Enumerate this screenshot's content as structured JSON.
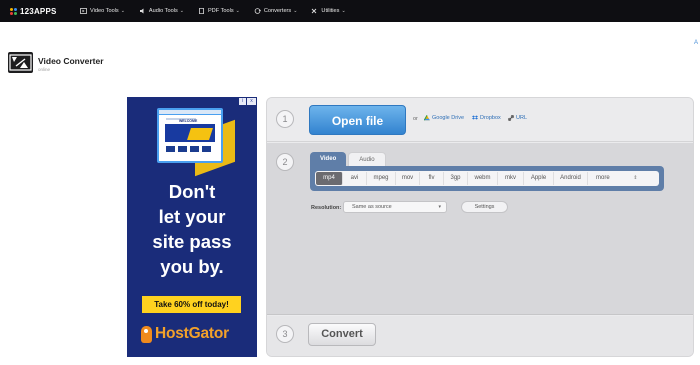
{
  "nav": {
    "logo": "123APPS",
    "items": [
      {
        "label": "Video Tools",
        "icon": "video-icon"
      },
      {
        "label": "Audio Tools",
        "icon": "audio-icon"
      },
      {
        "label": "PDF Tools",
        "icon": "pdf-icon"
      },
      {
        "label": "Converters",
        "icon": "converter-icon"
      },
      {
        "label": "Utilities",
        "icon": "utilities-icon"
      }
    ],
    "edge_letter": "A"
  },
  "app": {
    "title": "Video Converter",
    "subtitle": "online",
    "icon": "video-converter-icon"
  },
  "ad": {
    "headline_lines": [
      "Don't",
      "let your",
      "site pass",
      "you by."
    ],
    "cta": "Take 60% off today!",
    "brand": "HostGator",
    "mock_title": "WELCOME",
    "badge_info": "i",
    "badge_close": "x"
  },
  "steps": {
    "step1": "1",
    "step2": "2",
    "step3": "3"
  },
  "open": {
    "button": "Open file",
    "or": "or",
    "sources": [
      {
        "label": "Google Drive",
        "icon": "google-drive-icon",
        "color": "#2f9a48"
      },
      {
        "label": "Dropbox",
        "icon": "dropbox-icon",
        "color": "#2a77d6"
      },
      {
        "label": "URL",
        "icon": "link-icon",
        "color": "#555555"
      }
    ]
  },
  "convert_settings": {
    "tabs": [
      "Video",
      "Audio"
    ],
    "active_tab": "Video",
    "formats": [
      "mp4",
      "avi",
      "mpeg",
      "mov",
      "flv",
      "3gp",
      "webm",
      "mkv",
      "Apple",
      "Android",
      "more"
    ],
    "selected_format": "mp4",
    "resolution_label": "Resolution:",
    "resolution_value": "Same as source",
    "settings_button": "Settings"
  },
  "convert": {
    "button": "Convert"
  },
  "colors": {
    "nav_bg": "#0e0e12",
    "open_button": "#3383d0",
    "format_bar": "#5f7ea8",
    "ad_bg": "#1a2c7a",
    "ad_cta": "#ffd21f",
    "ad_brand": "#f3a12a"
  }
}
